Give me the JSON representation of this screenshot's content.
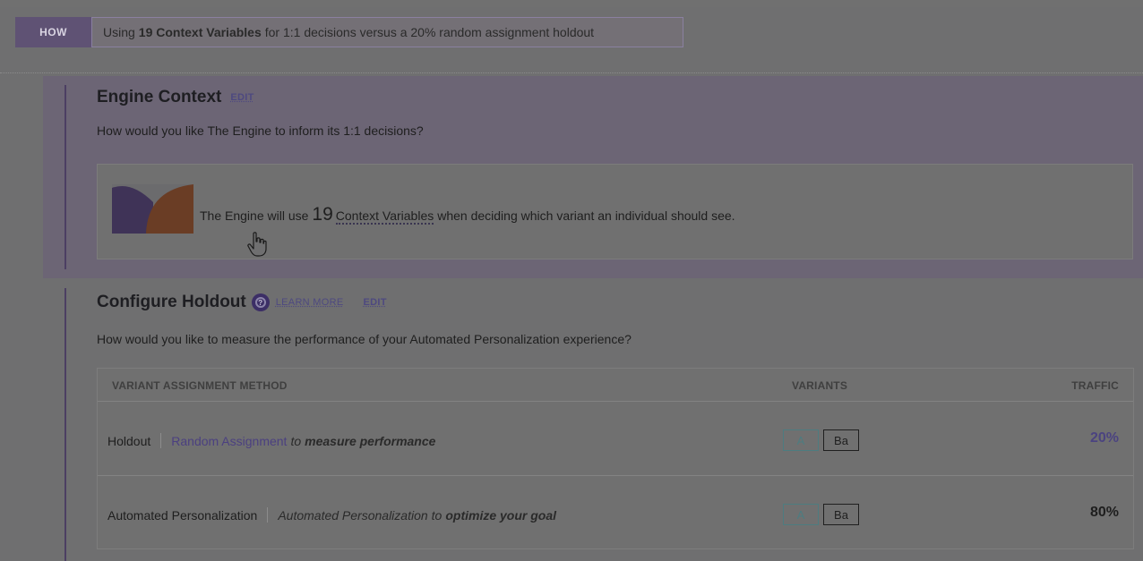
{
  "how": {
    "tag": "HOW",
    "prefix": "Using",
    "bold": "19 Context Variables",
    "suffix": "for 1:1 decisions versus a 20% random assignment holdout"
  },
  "engine": {
    "title": "Engine Context",
    "edit_label": "EDIT",
    "question": "How would you like The Engine to inform its 1:1 decisions?",
    "line_prefix": "The Engine will use",
    "count": "19",
    "link": "Context Variables",
    "line_suffix": "when deciding which variant an individual should see."
  },
  "holdout": {
    "title": "Configure Holdout",
    "learn_more_label": "LEARN MORE",
    "edit_label": "EDIT",
    "question": "How would you like to measure the performance of your Automated Personalization experience?",
    "columns": [
      "VARIANT ASSIGNMENT METHOD",
      "VARIANTS",
      "TRAFFIC"
    ],
    "rows": [
      {
        "name": "Holdout",
        "method": "Random Assignment",
        "to": "to",
        "goal": "measure performance",
        "variants": [
          "A",
          "Ba"
        ],
        "traffic": "20%"
      },
      {
        "name": "Automated Personalization",
        "method": "Automated Personalization",
        "to": "to",
        "goal": "optimize your goal",
        "variants": [
          "A",
          "Ba"
        ],
        "traffic": "80%"
      }
    ]
  },
  "colors": {
    "accent": "#4b4380",
    "overlay": "#6f6f70"
  }
}
